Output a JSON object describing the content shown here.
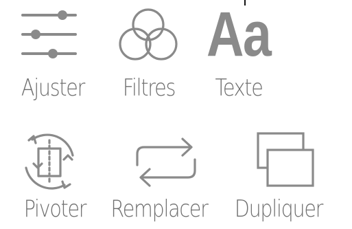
{
  "colors": {
    "icon": "#8a8a8a",
    "label": "#6f6f6f",
    "background": "#ffffff"
  },
  "tools": [
    {
      "label": "Ajuster",
      "icon": "sliders-icon"
    },
    {
      "label": "Filtres",
      "icon": "filters-icon"
    },
    {
      "label": "Texte",
      "icon": "text-icon",
      "glyph": "Aa"
    },
    {
      "label": "Pivoter",
      "icon": "rotate-icon"
    },
    {
      "label": "Remplacer",
      "icon": "replace-icon"
    },
    {
      "label": "Dupliquer",
      "icon": "duplicate-icon"
    }
  ]
}
